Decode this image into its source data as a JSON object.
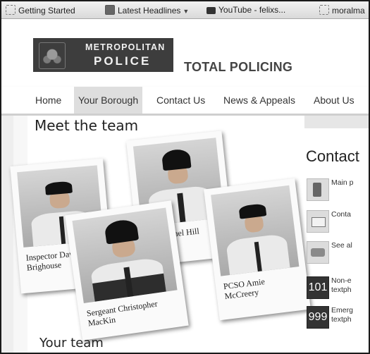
{
  "bookmarks": [
    {
      "label": "Getting Started",
      "icon": "page-icon"
    },
    {
      "label": "Latest Headlines",
      "icon": "rss-icon",
      "has_menu": true
    },
    {
      "label": "YouTube - felixs...",
      "icon": "youtube-icon"
    },
    {
      "label": "moralma",
      "icon": "page-icon"
    }
  ],
  "header": {
    "logo_line1": "METROPOLITAN",
    "logo_line2": "POLICE",
    "tagline": "TOTAL POLICING"
  },
  "nav": {
    "items": [
      "Home",
      "Your Borough",
      "Contact Us",
      "News & Appeals",
      "About Us"
    ],
    "active": "Your Borough"
  },
  "main": {
    "title": "Meet the team",
    "team_members": [
      {
        "caption": "Inspector Davi Brighouse"
      },
      {
        "caption": "PC Michael Hill"
      },
      {
        "caption": "PCSO Amie McCreery"
      },
      {
        "caption": "Sergeant Christopher MacKin"
      }
    ],
    "your_team": "Your team"
  },
  "contact": {
    "title": "Contact",
    "rows": [
      {
        "icon": "mobile-phone-icon",
        "text": "Main p"
      },
      {
        "icon": "envelope-icon",
        "text": "Conta"
      },
      {
        "icon": "building-icon",
        "text": "See al"
      },
      {
        "icon": "number-icon",
        "badge": "101",
        "text": "Non-e\ntextph"
      },
      {
        "icon": "number-icon",
        "badge": "999",
        "text": "Emerg\ntextph"
      }
    ]
  },
  "colors": {
    "logo_bg": "#3d3d3d",
    "nav_active": "#dedede",
    "contact_badge": "#333333"
  }
}
